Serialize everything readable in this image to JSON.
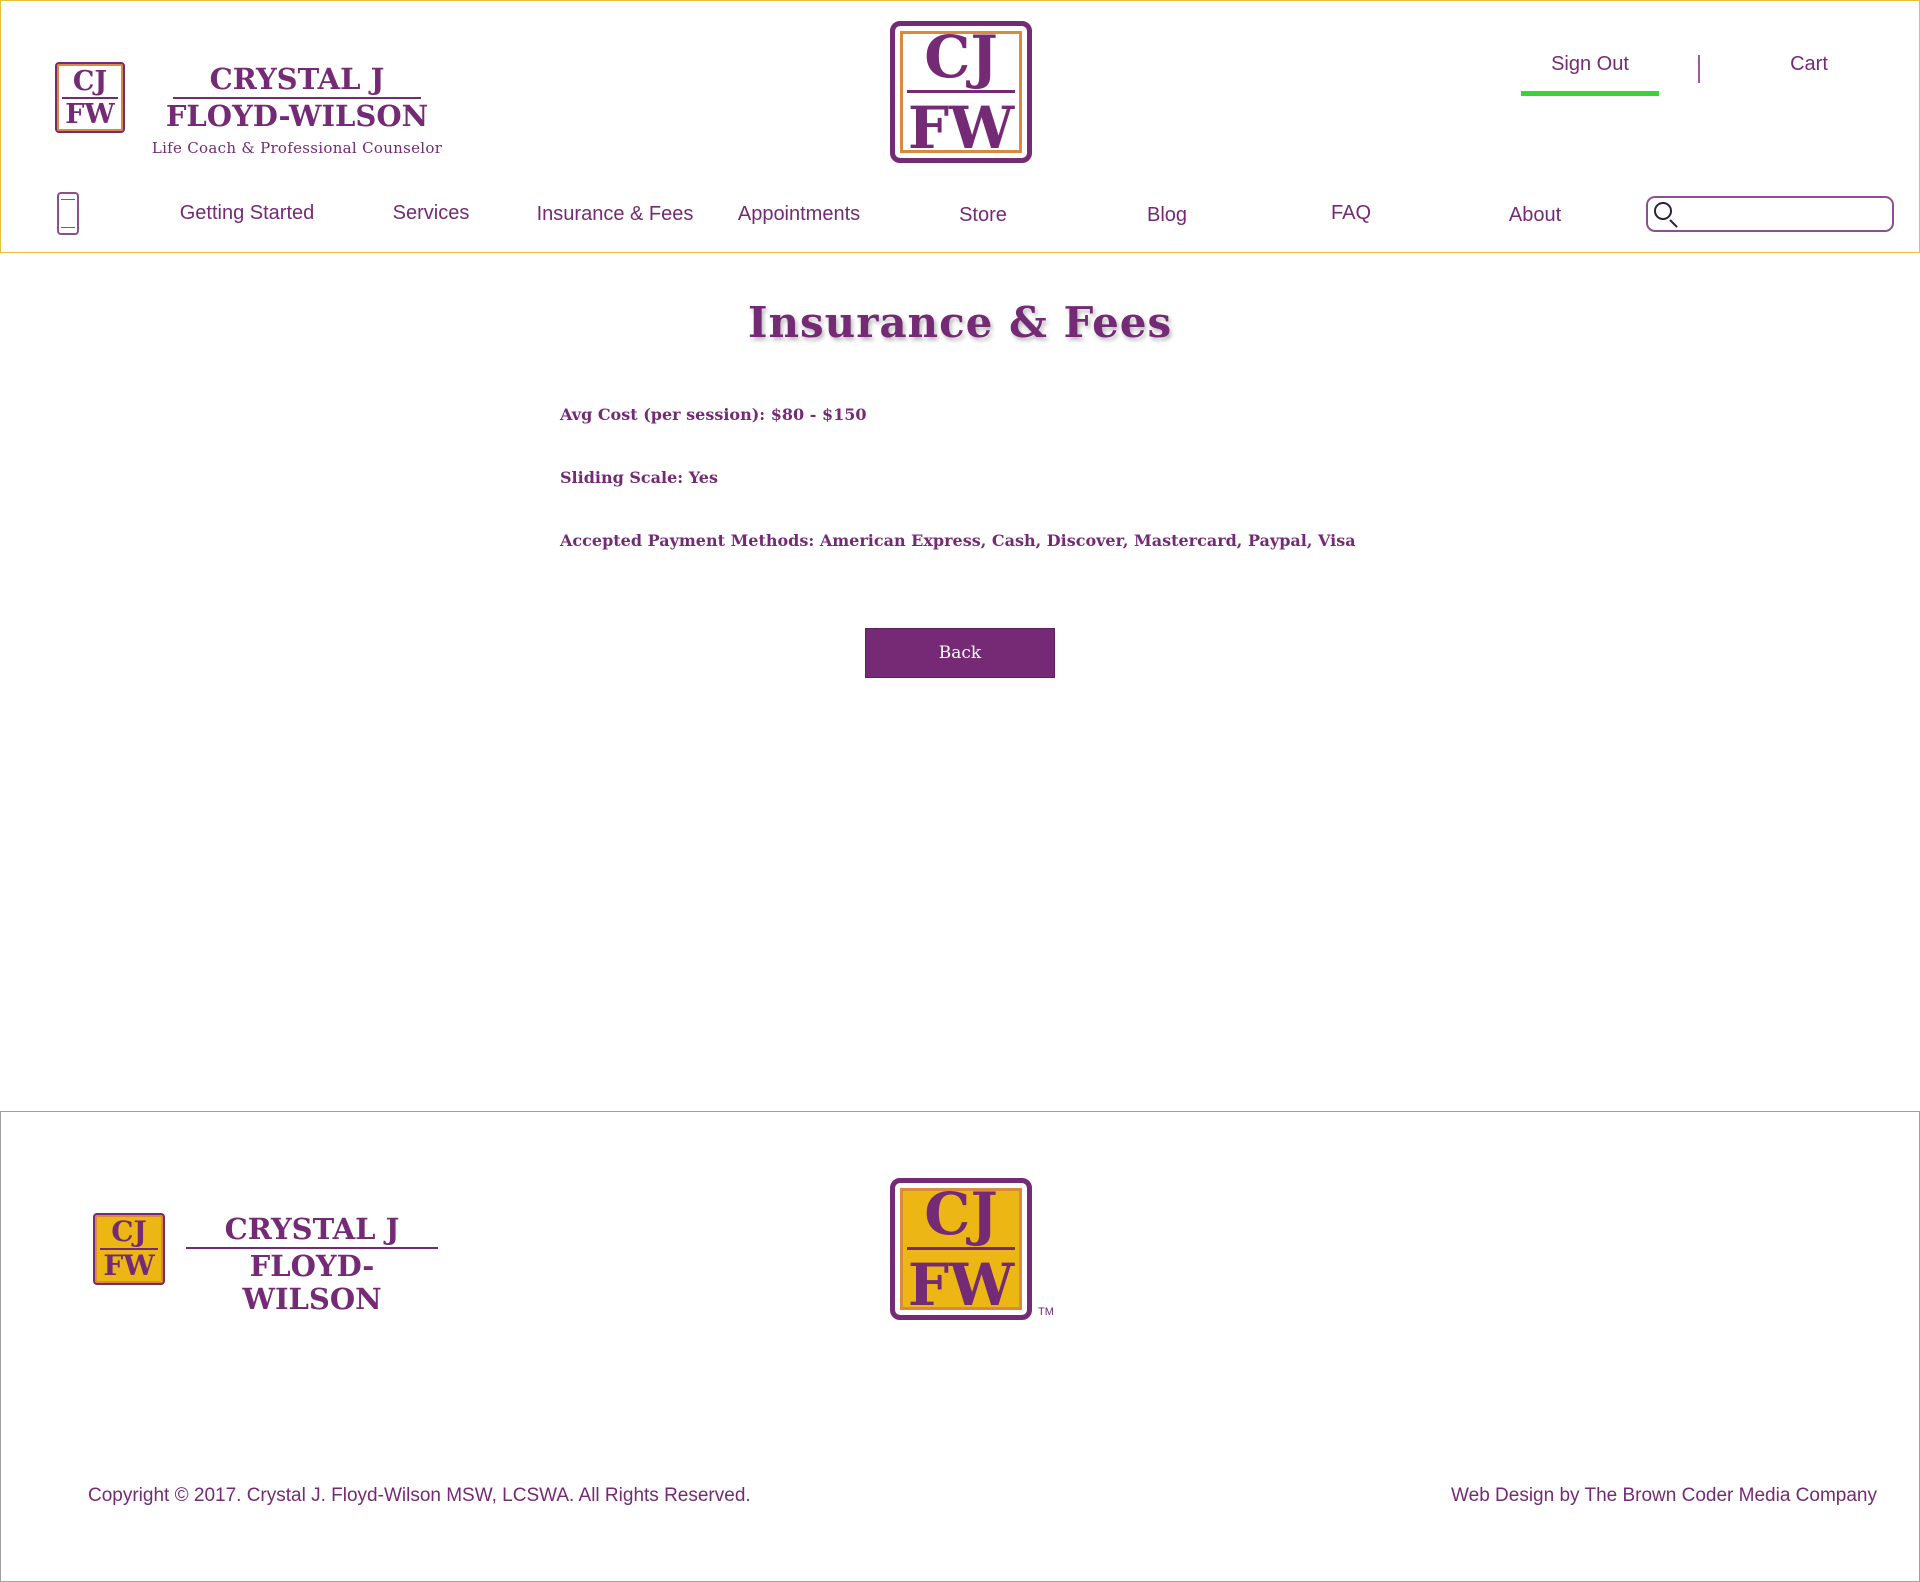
{
  "header": {
    "logo_small": {
      "top": "CJ",
      "bottom": "FW"
    },
    "brand": {
      "line1": "CRYSTAL J",
      "line2": "FLOYD-WILSON",
      "tagline": "Life Coach & Professional Counselor"
    },
    "logo_center": {
      "top": "CJ",
      "bottom": "FW"
    },
    "account": {
      "sign_out": "Sign Out",
      "cart": "Cart"
    },
    "nav": [
      {
        "label": "Getting Started"
      },
      {
        "label": "Services"
      },
      {
        "label": "Insurance & Fees"
      },
      {
        "label": "Appointments"
      },
      {
        "label": "Store"
      },
      {
        "label": "Blog"
      },
      {
        "label": "FAQ"
      },
      {
        "label": "About"
      }
    ],
    "search": {
      "value": "",
      "placeholder": ""
    },
    "icons": {
      "mobile": "mobile-phone-icon",
      "search": "search-icon"
    }
  },
  "main": {
    "title": "Insurance & Fees",
    "info": [
      "Avg Cost (per session): $80 - $150",
      "Sliding Scale: Yes",
      "Accepted Payment Methods: American Express, Cash, Discover, Mastercard, Paypal, Visa"
    ],
    "back_label": "Back"
  },
  "footer": {
    "logo_small": {
      "top": "CJ",
      "bottom": "FW"
    },
    "brand": {
      "line1": "CRYSTAL J",
      "line2": "FLOYD-WILSON"
    },
    "logo_center": {
      "top": "CJ",
      "bottom": "FW"
    },
    "trademark": "TM",
    "copyright": "Copyright © 2017. Crystal J. Floyd-Wilson MSW, LCSWA.  All Rights Reserved.",
    "credit": "Web Design by The Brown Coder Media Company"
  },
  "colors": {
    "brand_purple": "#742a74",
    "brand_gold": "#ecb714",
    "active_underline": "#3ad33a",
    "header_border": "#e6c23a",
    "button_bg": "#762a76"
  }
}
